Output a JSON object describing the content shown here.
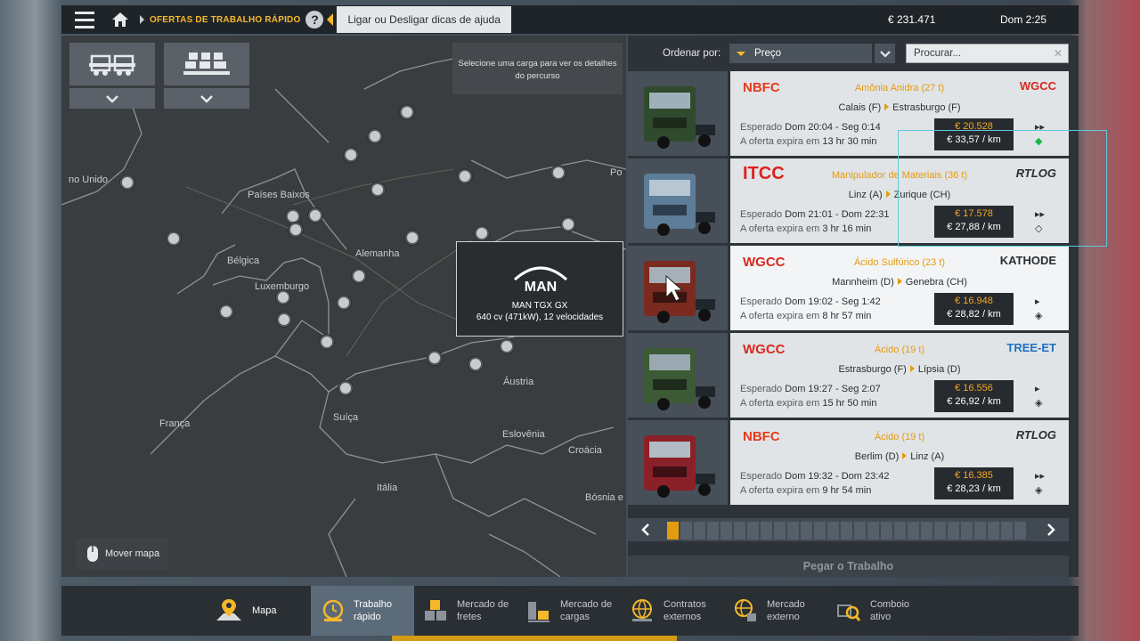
{
  "topbar": {
    "crumb": "OFERTAS DE TRABALHO RÁPIDO",
    "help": "?",
    "tip": "Ligar ou Desligar dicas de ajuda",
    "money": "€ 231.471",
    "time": "Dom 2:25"
  },
  "map": {
    "select_hint": "Selecione uma carga para ver os detalhes do percurso",
    "truck_brand": "MAN",
    "truck_name": "MAN TGX GX",
    "truck_spec": "640 cv (471kW), 12 velocidades",
    "move_map": "Mover mapa",
    "labels": [
      "no Unido",
      "Países Baixos",
      "Alemanha",
      "Bélgica",
      "Luxemburgo",
      "França",
      "Suíça",
      "Áustria",
      "Eslovênia",
      "Croácia",
      "Itália",
      "Bósnia e",
      "Po"
    ]
  },
  "sort": {
    "label": "Ordenar por:",
    "value": "Preço",
    "search_placeholder": "Procurar..."
  },
  "jobs": [
    {
      "company": "NBFC",
      "cargo": "Amônia Anidra (27 t)",
      "dest_company": "WGCC",
      "from": "Calais (F)",
      "to": "Estrasburgo (F)",
      "expected_label": "Esperado",
      "expected": "Dom 20:04 - Seg 0:14",
      "offer_label": "A oferta expira em",
      "offer": "13 hr 30 min",
      "price": "€ 20.528",
      "per_km": "€ 33,57 / km"
    },
    {
      "company": "ITCC",
      "cargo": "Manipulador de Materiais (36 t)",
      "dest_company": "RTLOG",
      "from": "Linz (A)",
      "to": "Zurique (CH)",
      "expected_label": "Esperado",
      "expected": "Dom 21:01 - Dom 22:31",
      "offer_label": "A oferta expira em",
      "offer": "3 hr 16 min",
      "price": "€ 17.578",
      "per_km": "€ 27,88 / km"
    },
    {
      "company": "WGCC",
      "cargo": "Ácido Sulfúrico (23 t)",
      "dest_company": "KATHODE",
      "from": "Mannheim (D)",
      "to": "Genebra (CH)",
      "expected_label": "Esperado",
      "expected": "Dom 19:02 - Seg 1:42",
      "offer_label": "A oferta expira em",
      "offer": "8 hr 57 min",
      "price": "€ 16.948",
      "per_km": "€ 28,82 / km"
    },
    {
      "company": "WGCC",
      "cargo": "Ácido (19 t)",
      "dest_company": "TREE-ET",
      "from": "Estrasburgo (F)",
      "to": "Lípsia (D)",
      "expected_label": "Esperado",
      "expected": "Dom 19:27 - Seg 2:07",
      "offer_label": "A oferta expira em",
      "offer": "15 hr 50 min",
      "price": "€ 16.556",
      "per_km": "€ 26,92 / km"
    },
    {
      "company": "NBFC",
      "cargo": "Ácido (19 t)",
      "dest_company": "RTLOG",
      "from": "Berlim (D)",
      "to": "Linz (A)",
      "expected_label": "Esperado",
      "expected": "Dom 19:32 - Dom 23:42",
      "offer_label": "A oferta expira em",
      "offer": "9 hr 54 min",
      "price": "€ 16.385",
      "per_km": "€ 28,23 / km"
    }
  ],
  "take_job": "Pegar o Trabalho",
  "bottom_tabs": [
    {
      "label": "Mapa"
    },
    {
      "label": "Trabalho\nrápido"
    },
    {
      "label": "Mercado de\nfretes"
    },
    {
      "label": "Mercado de\ncargas"
    },
    {
      "label": "Contratos\nexternos"
    },
    {
      "label": "Mercado\nexterno"
    },
    {
      "label": "Comboio\nativo"
    }
  ],
  "colors": {
    "accent": "#f5b82a",
    "price": "#f5a623",
    "active_tab": "#5b6b7a"
  }
}
